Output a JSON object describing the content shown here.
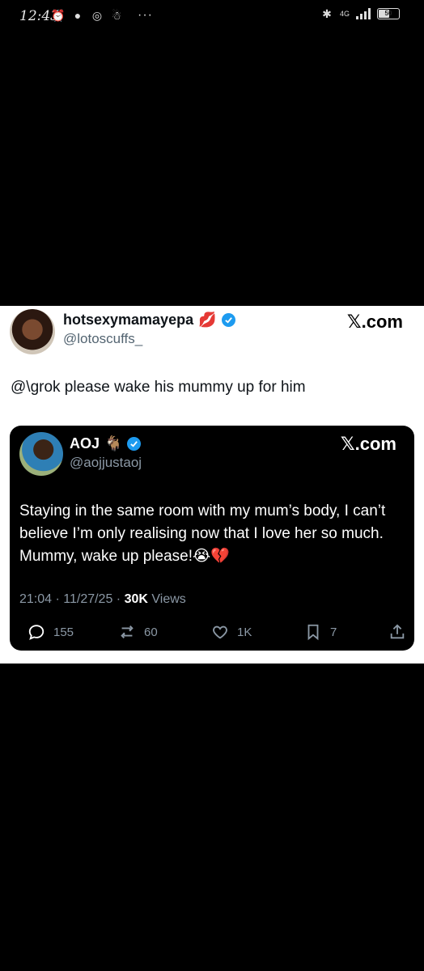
{
  "status_bar": {
    "time": "12:43",
    "network": "4G",
    "battery": "50"
  },
  "reply_tweet": {
    "display_name": "hotsexymamayepa",
    "name_emoji": "💋",
    "handle": "@lotoscuffs_",
    "watermark": "𝕏.com",
    "text": "@\\grok please wake his mummy up for him"
  },
  "quoted_tweet": {
    "display_name": "AOJ",
    "name_emoji": "🐐",
    "handle": "@aojjustaoj",
    "watermark": "𝕏.com",
    "text": "Staying in the same room with my mum’s body, I can’t believe I’m only realising now that I love her so much. Mummy, wake up please!😭💔",
    "timestamp": "21:04 · 11/27/25 · ",
    "views_count": "30K",
    "views_label": " Views",
    "replies": "155",
    "reposts": "60",
    "likes": "1K",
    "bookmarks": "7"
  },
  "colors": {
    "verified": "#1d9bf0",
    "muted": "#8b98a5",
    "handle_light": "#536471"
  }
}
